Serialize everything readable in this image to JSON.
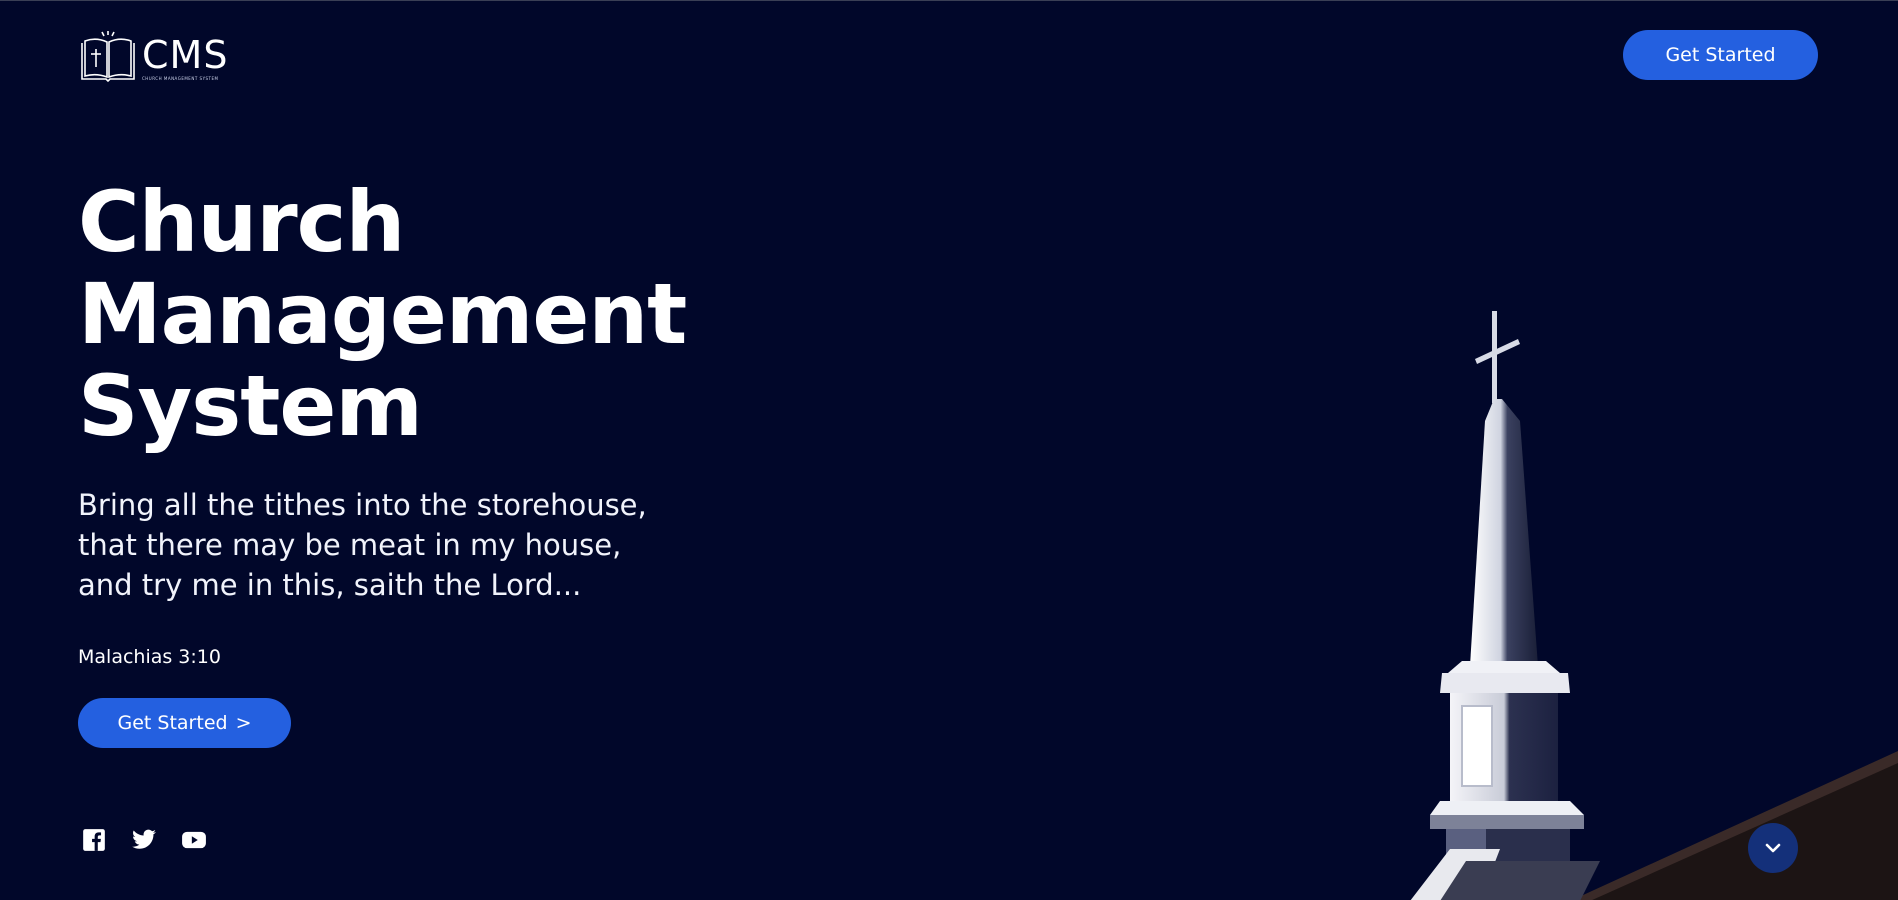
{
  "header": {
    "logo_title": "CMS",
    "logo_subtitle": "CHURCH MANAGEMENT SYSTEM",
    "cta_label": "Get Started"
  },
  "hero": {
    "title_lines": [
      "Church",
      "Management",
      "System"
    ],
    "verse_lines": [
      "Bring all the tithes into the storehouse,",
      "that there may be meat in my house,",
      "and try me in this, saith the Lord..."
    ],
    "verse_reference": "Malachias 3:10",
    "cta_label": "Get Started",
    "cta_arrow": ">"
  },
  "social": [
    {
      "name": "facebook-icon"
    },
    {
      "name": "twitter-icon"
    },
    {
      "name": "youtube-icon"
    }
  ],
  "colors": {
    "background": "#01072a",
    "accent": "#2460e0",
    "scroll_button": "#14307a",
    "text": "#ffffff"
  }
}
